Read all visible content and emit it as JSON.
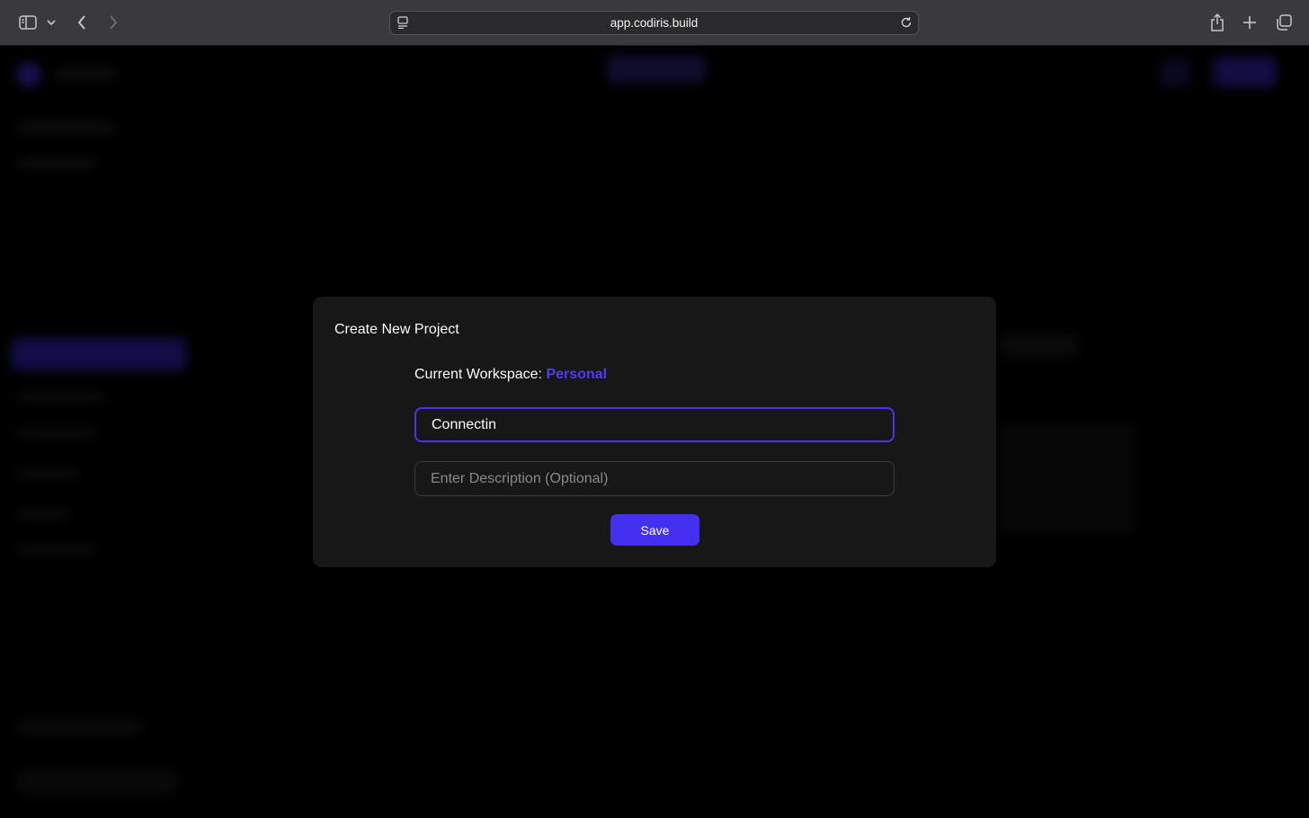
{
  "browser": {
    "url": "app.codiris.build"
  },
  "modal": {
    "title": "Create New Project",
    "workspace_label": "Current Workspace:",
    "workspace_value": "Personal",
    "name_value": "Connectin",
    "description_placeholder": "Enter Description (Optional)",
    "save_label": "Save"
  },
  "colors": {
    "accent": "#4530f0",
    "modal_bg": "#171717",
    "page_bg": "#000000"
  }
}
